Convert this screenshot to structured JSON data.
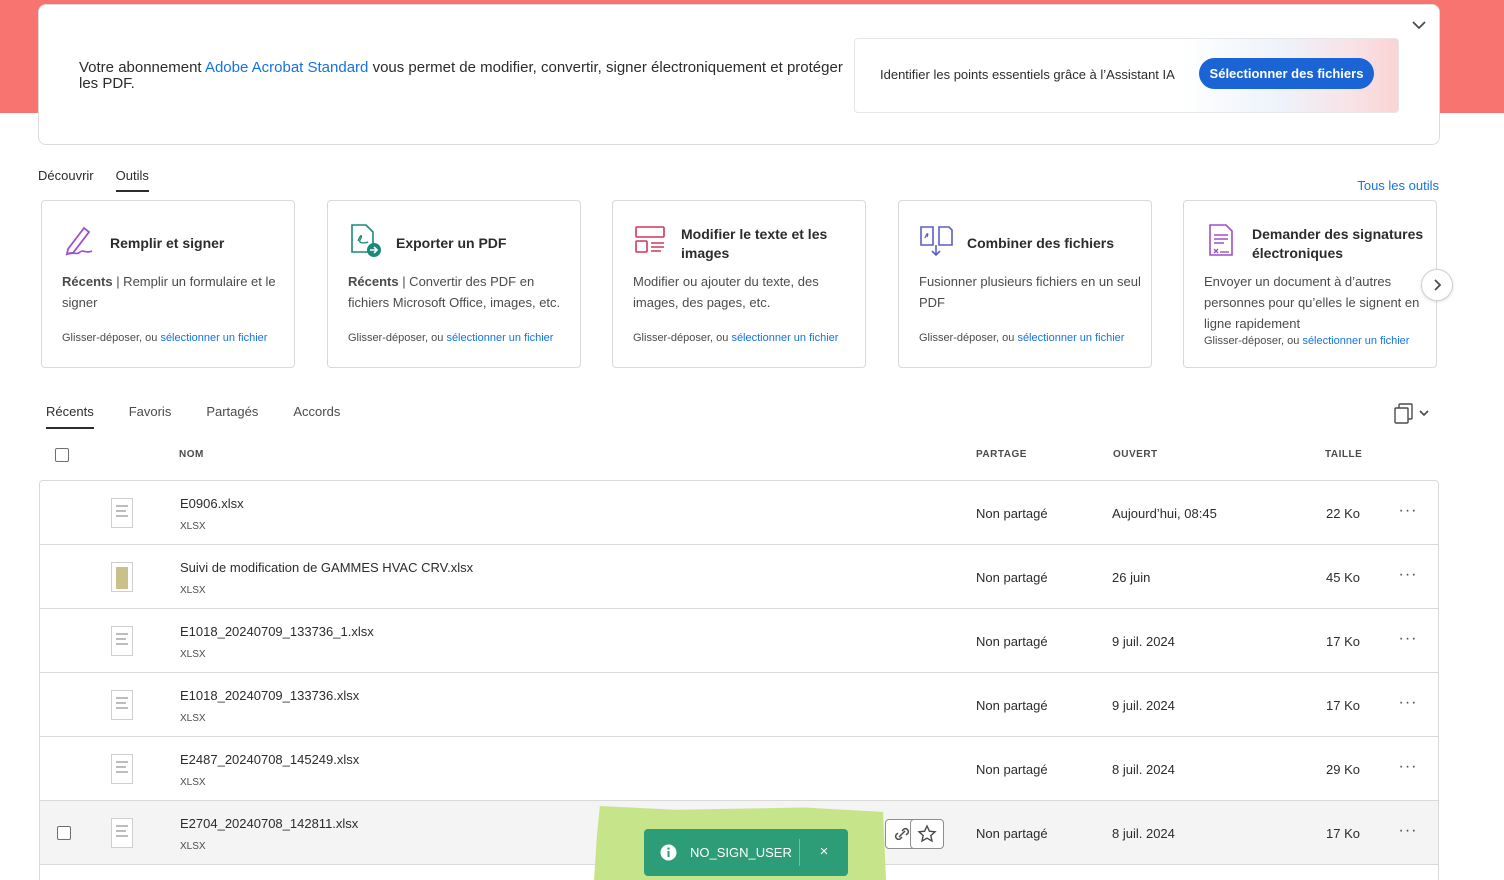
{
  "banner": {
    "text_before": "Votre abonnement ",
    "brand": "Adobe Acrobat Standard",
    "text_after": " vous permet de modifier, convertir, signer électroniquement et protéger les PDF.",
    "ai_text": "Identifier les points essentiels grâce à l’Assistant IA",
    "ai_button": "Sélectionner des fichiers"
  },
  "main_tabs": [
    {
      "label": "Découvrir"
    },
    {
      "label": "Outils"
    }
  ],
  "all_tools": "Tous les outils",
  "tools": [
    {
      "title": "Remplir et signer",
      "desc_bold": "Récents",
      "desc": " | Remplir un formulaire et le signer",
      "foot": "Glisser-déposer, ou ",
      "link": "sélectionner un fichier"
    },
    {
      "title": "Exporter un PDF",
      "desc_bold": "Récents",
      "desc": " | Convertir des PDF en fichiers Microsoft Office, images, etc.",
      "foot": "Glisser-déposer, ou ",
      "link": "sélectionner un fichier"
    },
    {
      "title": "Modifier le texte et les images",
      "desc_bold": "",
      "desc": "Modifier ou ajouter du texte, des images, des pages, etc.",
      "foot": "Glisser-déposer, ou ",
      "link": "sélectionner un fichier"
    },
    {
      "title": "Combiner des fichiers",
      "desc_bold": "",
      "desc": "Fusionner plusieurs fichiers en un seul PDF",
      "foot": "Glisser-déposer, ou ",
      "link": "sélectionner un fichier"
    },
    {
      "title": "Demander des signatures électroniques",
      "desc_bold": "",
      "desc": "Envoyer un document à d’autres personnes pour qu’elles le signent en ligne rapidement",
      "foot": "Glisser-déposer, ou ",
      "link": "sélectionner un fichier"
    }
  ],
  "file_tabs": [
    {
      "label": "Récents"
    },
    {
      "label": "Favoris"
    },
    {
      "label": "Partagés"
    },
    {
      "label": "Accords"
    }
  ],
  "columns": {
    "name": "NOM",
    "share": "PARTAGE",
    "opened": "OUVERT",
    "size": "TAILLE"
  },
  "files": [
    {
      "name": "E0906.xlsx",
      "type": "XLSX",
      "share": "Non partagé",
      "opened": "Aujourd’hui, 08:45",
      "size": "22 Ko"
    },
    {
      "name": "Suivi de modification de GAMMES  HVAC CRV.xlsx",
      "type": "XLSX",
      "share": "Non partagé",
      "opened": "26 juin",
      "size": "45 Ko"
    },
    {
      "name": "E1018_20240709_133736_1.xlsx",
      "type": "XLSX",
      "share": "Non partagé",
      "opened": "9 juil. 2024",
      "size": "17 Ko"
    },
    {
      "name": "E1018_20240709_133736.xlsx",
      "type": "XLSX",
      "share": "Non partagé",
      "opened": "9 juil. 2024",
      "size": "17 Ko"
    },
    {
      "name": "E2487_20240708_145249.xlsx",
      "type": "XLSX",
      "share": "Non partagé",
      "opened": "8 juil. 2024",
      "size": "29 Ko"
    },
    {
      "name": "E2704_20240708_142811.xlsx",
      "type": "XLSX",
      "share": "Non partagé",
      "opened": "8 juil. 2024",
      "size": "17 Ko"
    }
  ],
  "more_label": "···",
  "toast": {
    "text": "NO_SIGN_USER",
    "close": "×"
  },
  "colors": {
    "accent": "#1473e6",
    "banner_bg": "#f87470",
    "toast": "#2d9d78",
    "ai_button": "#1a64d6"
  }
}
